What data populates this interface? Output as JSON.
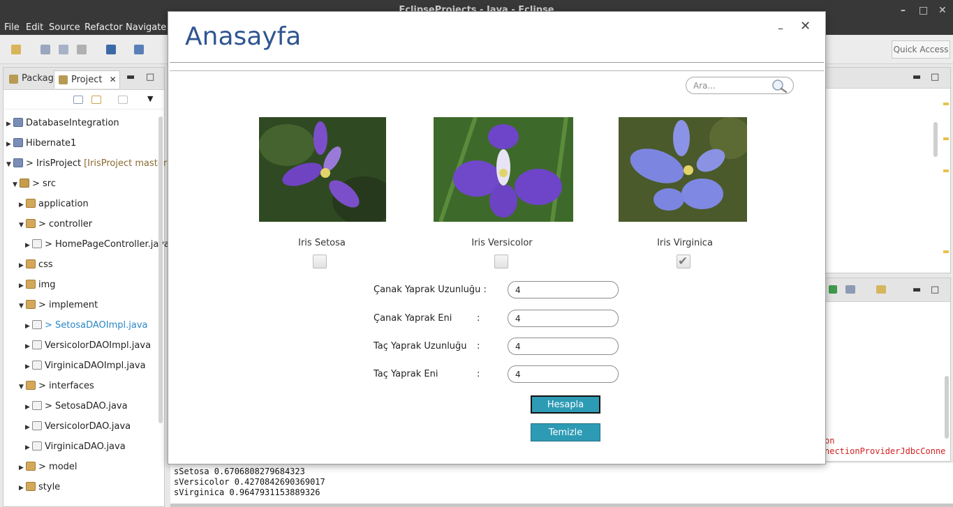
{
  "eclipse": {
    "window_title": "EclipseProjects - Java - Eclipse",
    "menu": [
      "File",
      "Edit",
      "Source",
      "Refactor",
      "Navigate"
    ],
    "quick_access": "Quick Access",
    "view_tabs": {
      "packages": "Packag",
      "project": "Project"
    },
    "tree": [
      {
        "label": "DatabaseIntegration",
        "branch": "",
        "icon": "project-icon",
        "expanded": false,
        "level": 0
      },
      {
        "label": "Hibernate1",
        "branch": "",
        "icon": "project-icon",
        "expanded": false,
        "level": 0
      },
      {
        "label": "> IrisProject",
        "branch": "[IrisProject master]",
        "icon": "project-icon",
        "expanded": true,
        "level": 0
      },
      {
        "label": "> src",
        "branch": "",
        "icon": "folder-icon",
        "expanded": true,
        "level": 1
      },
      {
        "label": "application",
        "branch": "",
        "icon": "package-icon",
        "expanded": false,
        "level": 2
      },
      {
        "label": "> controller",
        "branch": "",
        "icon": "package-icon",
        "expanded": true,
        "level": 2
      },
      {
        "label": "> HomePageController.java",
        "branch": "",
        "icon": "java-icon",
        "expanded": false,
        "level": 3
      },
      {
        "label": "css",
        "branch": "",
        "icon": "package-icon",
        "expanded": false,
        "level": 2
      },
      {
        "label": "img",
        "branch": "",
        "icon": "package-icon",
        "expanded": false,
        "level": 2
      },
      {
        "label": "> implement",
        "branch": "",
        "icon": "package-icon",
        "expanded": true,
        "level": 2
      },
      {
        "label": "> SetosaDAOImpl.java",
        "branch": "",
        "icon": "java-icon",
        "expanded": false,
        "level": 3,
        "selected": true
      },
      {
        "label": "VersicolorDAOImpl.java",
        "branch": "",
        "icon": "java-icon",
        "expanded": false,
        "level": 3
      },
      {
        "label": "VirginicaDAOImpl.java",
        "branch": "",
        "icon": "java-icon",
        "expanded": false,
        "level": 3
      },
      {
        "label": "> interfaces",
        "branch": "",
        "icon": "package-icon",
        "expanded": true,
        "level": 2
      },
      {
        "label": "> SetosaDAO.java",
        "branch": "",
        "icon": "java-icon",
        "expanded": false,
        "level": 3
      },
      {
        "label": "VersicolorDAO.java",
        "branch": "",
        "icon": "java-icon",
        "expanded": false,
        "level": 3
      },
      {
        "label": "VirginicaDAO.java",
        "branch": "",
        "icon": "java-icon",
        "expanded": false,
        "level": 3
      },
      {
        "label": "> model",
        "branch": "",
        "icon": "package-icon",
        "expanded": false,
        "level": 2
      },
      {
        "label": "style",
        "branch": "",
        "icon": "package-icon",
        "expanded": false,
        "level": 2
      }
    ],
    "console": {
      "error_lines": [
        "on",
        "nectionProviderJdbcConne"
      ],
      "lines": [
        "sSetosa 0.6706808279684323",
        "sVersicolor 0.4270842690369017",
        "sVirginica 0.9647931153889326"
      ]
    }
  },
  "dialog": {
    "title": "Anasayfa",
    "minimize": "–",
    "close": "✕",
    "search_placeholder": "Ara...",
    "flowers": [
      {
        "label": "Iris Setosa",
        "checked": false,
        "petal": "#7b4fc9",
        "bg": "#2f4a22"
      },
      {
        "label": "Iris Versicolor",
        "checked": false,
        "petal": "#6e45c8",
        "bg": "#3d6a2a"
      },
      {
        "label": "Iris Virginica",
        "checked": true,
        "petal": "#7c86e0",
        "bg": "#4a5a2a"
      }
    ],
    "fields": [
      {
        "label": "Çanak Yaprak Uzunluğu :",
        "colon": "",
        "value": "4"
      },
      {
        "label": "Çanak Yaprak Eni",
        "colon": ":",
        "value": "4"
      },
      {
        "label": "Taç Yaprak Uzunluğu",
        "colon": ":",
        "value": "4"
      },
      {
        "label": "Taç Yaprak Eni",
        "colon": ":",
        "value": "4"
      }
    ],
    "buttons": {
      "calculate": "Hesapla",
      "clear": "Temizle"
    },
    "colors": {
      "title": "#2f5591",
      "button": "#2e9bb5"
    }
  }
}
